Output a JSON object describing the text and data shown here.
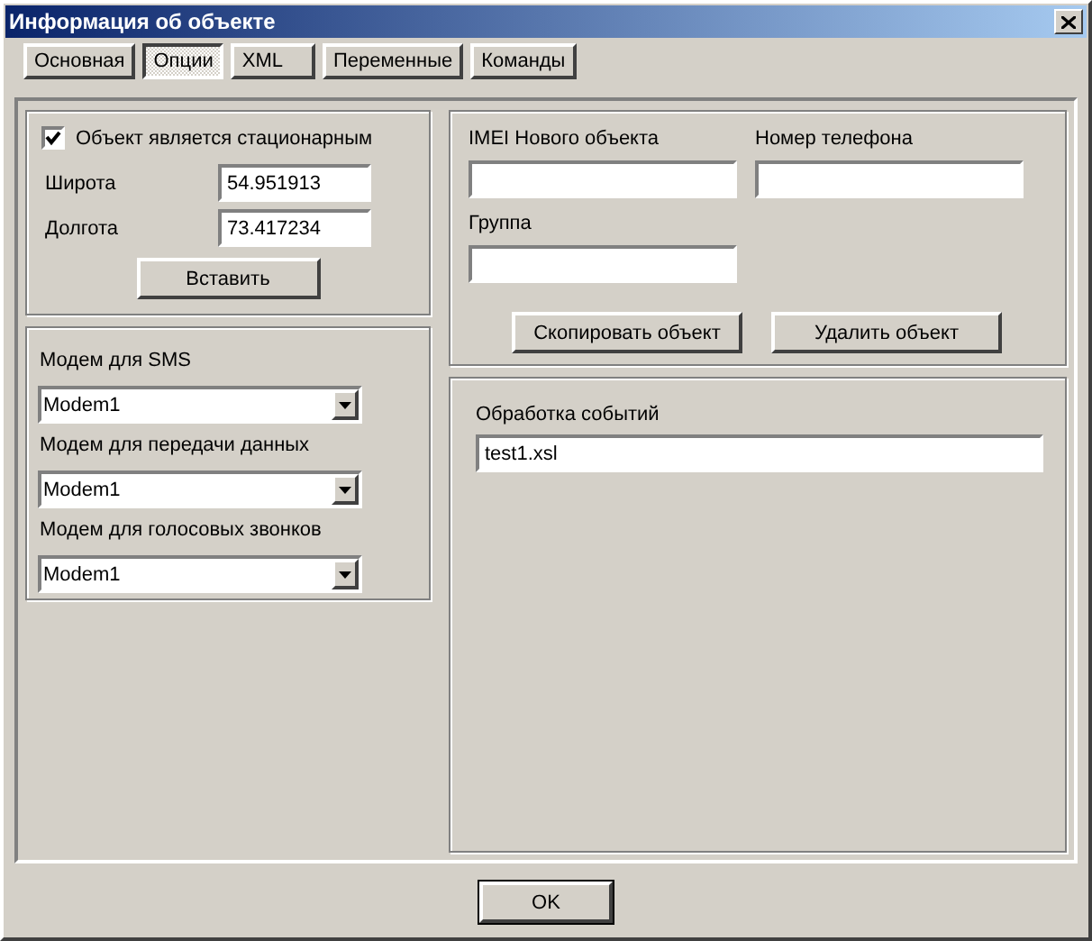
{
  "window": {
    "title": "Информация об объекте"
  },
  "tabs": [
    {
      "label": "Основная",
      "selected": false
    },
    {
      "label": "Опции",
      "selected": true
    },
    {
      "label": "XML",
      "selected": false
    },
    {
      "label": "Переменные",
      "selected": false
    },
    {
      "label": "Команды",
      "selected": false
    }
  ],
  "location": {
    "stationary": {
      "label": "Объект является стационарным",
      "checked": true
    },
    "fields": [
      {
        "label": "Широта",
        "value": "54.951913"
      },
      {
        "label": "Долгота",
        "value": "73.417234"
      }
    ],
    "insert_button": "Вставить"
  },
  "modems": [
    {
      "label": "Модем для SMS",
      "value": "Modem1"
    },
    {
      "label": "Модем для передачи данных",
      "value": "Modem1"
    },
    {
      "label": "Модем для голосовых звонков",
      "value": "Modem1"
    }
  ],
  "new_object": {
    "imei_label": "IMEI Нового объекта",
    "phone_label": "Номер телефона",
    "group_label": "Группа",
    "buttons": [
      "Скопировать объект",
      "Удалить объект"
    ]
  },
  "events": {
    "label": "Обработка событий",
    "value": "test1.xsl"
  },
  "buttons": [
    "OK"
  ]
}
